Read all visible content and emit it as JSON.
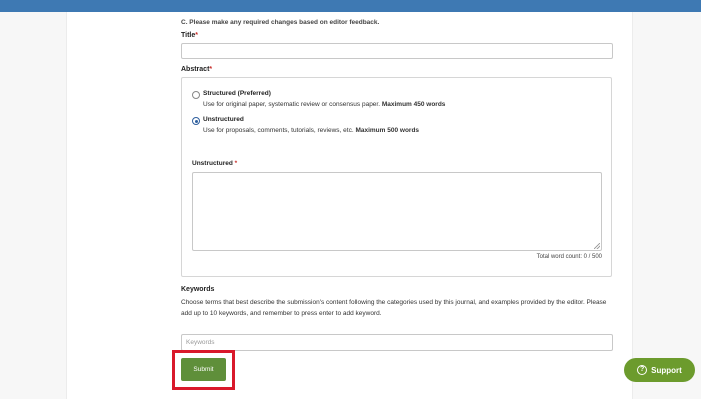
{
  "section": {
    "heading": "C. Please make any required changes based on editor feedback."
  },
  "title_field": {
    "label": "Title",
    "required_mark": "*",
    "value": ""
  },
  "abstract": {
    "label": "Abstract",
    "required_mark": "*",
    "options": [
      {
        "title": "Structured (Preferred)",
        "desc": "Use for original paper, systematic review or consensus paper.",
        "limit": "Maximum 450 words",
        "selected": false
      },
      {
        "title": "Unstructured",
        "desc": "Use for proposals, comments, tutorials, reviews, etc.",
        "limit": "Maximum 500 words",
        "selected": true
      }
    ],
    "unstructured_label": "Unstructured",
    "unstructured_required_mark": "*",
    "unstructured_value": "",
    "word_count": "Total word count: 0 / 500"
  },
  "keywords": {
    "label": "Keywords",
    "description": "Choose terms that best describe the submission's content following the categories used by this journal, and examples provided by the editor. Please add up to 10 keywords, and remember to press enter to add keyword.",
    "placeholder": "Keywords"
  },
  "actions": {
    "submit_label": "Submit"
  },
  "support": {
    "label": "Support",
    "icon": "question-circle-icon",
    "icon_glyph": "?"
  },
  "colors": {
    "top_bar": "#3e79b3",
    "submit_bg": "#5f8f3a",
    "support_bg": "#6c9b2d",
    "highlight": "#d9192b",
    "required": "#c9302c"
  }
}
